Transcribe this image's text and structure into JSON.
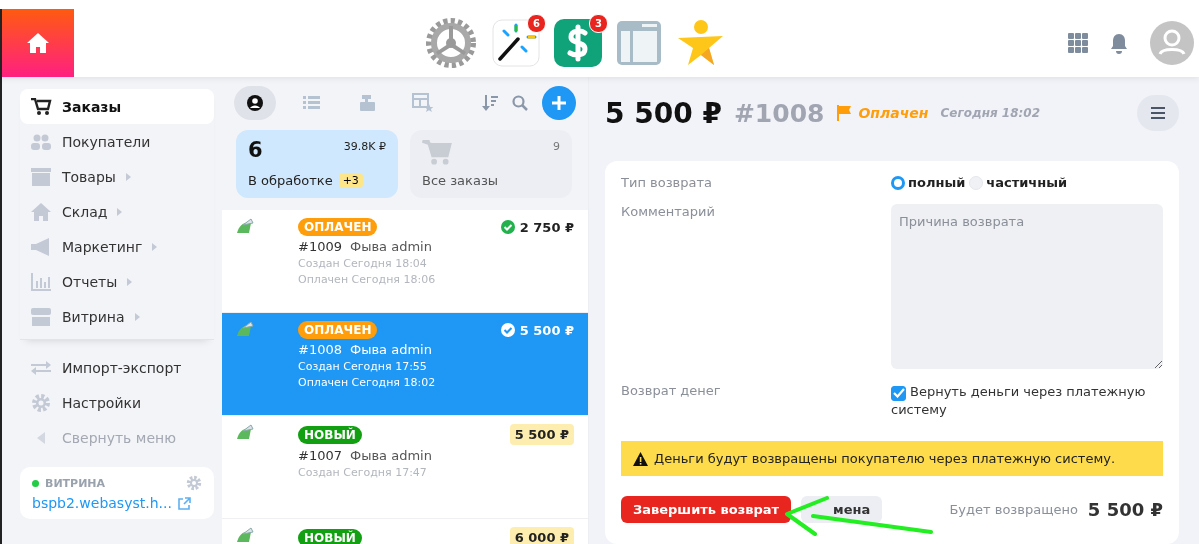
{
  "header": {
    "apps": [
      {
        "kind": "gear"
      },
      {
        "kind": "wand",
        "badge": "6"
      },
      {
        "kind": "dollar",
        "badge": "3"
      },
      {
        "kind": "layout"
      },
      {
        "kind": "star"
      }
    ]
  },
  "sidebar": {
    "items": [
      {
        "label": "Заказы",
        "selected": true,
        "submenu": false
      },
      {
        "label": "Покупатели",
        "selected": false,
        "submenu": false
      },
      {
        "label": "Товары",
        "selected": false,
        "submenu": true
      },
      {
        "label": "Склад",
        "selected": false,
        "submenu": true
      },
      {
        "label": "Маркетинг",
        "selected": false,
        "submenu": true
      },
      {
        "label": "Отчеты",
        "selected": false,
        "submenu": true
      },
      {
        "label": "Витрина",
        "selected": false,
        "submenu": true
      }
    ],
    "bottom_items": [
      {
        "label": "Импорт-экспорт",
        "muted": false
      },
      {
        "label": "Настройки",
        "muted": false
      },
      {
        "label": "Свернуть меню",
        "muted": true
      }
    ],
    "storefront": {
      "label": "ВИТРИНА",
      "online": true,
      "url": "bspb2.webasyst.h..."
    }
  },
  "toolbar": {
    "views": [
      {
        "selected": true
      },
      {
        "selected": false
      },
      {
        "selected": false
      },
      {
        "selected": false
      }
    ]
  },
  "filters": [
    {
      "kind": "count",
      "count": "6",
      "total": "39.8K ₽",
      "label": "В обработке",
      "badge": "+3",
      "selected": true
    },
    {
      "kind": "icon",
      "count": "9",
      "label": "Все заказы",
      "selected": false
    }
  ],
  "orders": [
    {
      "status": "ОПЛАЧЕН",
      "color": "#ff9d0a",
      "number": "#1009",
      "customer": "Фыва admin",
      "times": [
        "Создан Сегодня 18:04",
        "Оплачен Сегодня 18:06"
      ],
      "amount": "2 750 ₽",
      "paid": true,
      "selected": false
    },
    {
      "status": "ОПЛАЧЕН",
      "color": "#ff9d0a",
      "number": "#1008",
      "customer": "Фыва admin",
      "times": [
        "Создан Сегодня 17:55",
        "Оплачен Сегодня 18:02"
      ],
      "amount": "5 500 ₽",
      "paid": true,
      "selected": true
    },
    {
      "status": "НОВЫЙ",
      "color": "#12a012",
      "number": "#1007",
      "customer": "Фыва admin",
      "times": [
        "Создан Сегодня 17:47"
      ],
      "amount": "5 500 ₽",
      "paid": false,
      "selected": false
    },
    {
      "status": "НОВЫЙ",
      "color": "#12a012",
      "amount": "6 000 ₽",
      "paid": false,
      "selected": false
    }
  ],
  "order": {
    "total": "5 500 ₽",
    "number": "#1008",
    "state": "Оплачен",
    "date": "Сегодня 18:02"
  },
  "refund": {
    "type_label": "Тип возврата",
    "types": [
      {
        "label": "полный",
        "selected": true
      },
      {
        "label": "частичный",
        "selected": false
      }
    ],
    "comment_label": "Комментарий",
    "comment_placeholder": "Причина возврата",
    "money_label": "Возврат денег",
    "money_option": "Вернуть деньги через платежную систему",
    "money_checked": true,
    "warning": "Деньги будут возвращены покупателю через платежную систему.",
    "submit": "Завершить возврат",
    "cancel": "мена",
    "total_label": "Будет возвращено",
    "total": "5 500 ₽"
  }
}
